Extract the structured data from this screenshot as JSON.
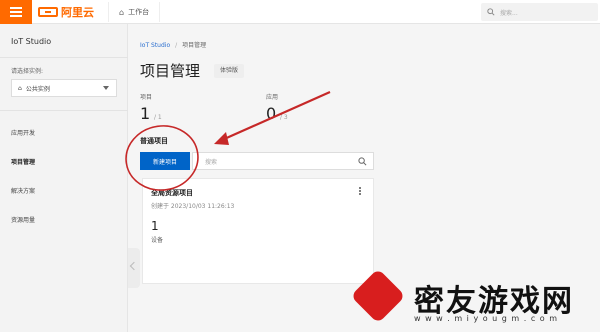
{
  "topbar": {
    "logo_text": "阿里云",
    "workbench_label": "工作台",
    "search_placeholder": "搜索..."
  },
  "sidebar": {
    "title": "IoT Studio",
    "instance_label": "请选择实例:",
    "instance_value": "公共实例",
    "nav": [
      {
        "label": "应用开发"
      },
      {
        "label": "项目管理"
      },
      {
        "label": "解决方案"
      },
      {
        "label": "资源用量"
      }
    ]
  },
  "main": {
    "breadcrumb": {
      "root": "IoT Studio",
      "current": "项目管理"
    },
    "title": "项目管理",
    "edition": "体验版",
    "stats": [
      {
        "label": "项目",
        "value": "1",
        "sub": "/ 1"
      },
      {
        "label": "应用",
        "value": "0",
        "sub": "/ 3"
      }
    ],
    "section_title": "普通项目",
    "new_button": "新建项目",
    "project_search_placeholder": "搜索",
    "card": {
      "title": "全局资源项目",
      "created": "创建于 2023/10/03 11:26:13",
      "count": "1",
      "unit": "设备"
    }
  },
  "annotation": {
    "color": "#c62828"
  },
  "watermark": {
    "text": "密友游戏网",
    "url": "w w w . m i y o u g m . c o m"
  }
}
